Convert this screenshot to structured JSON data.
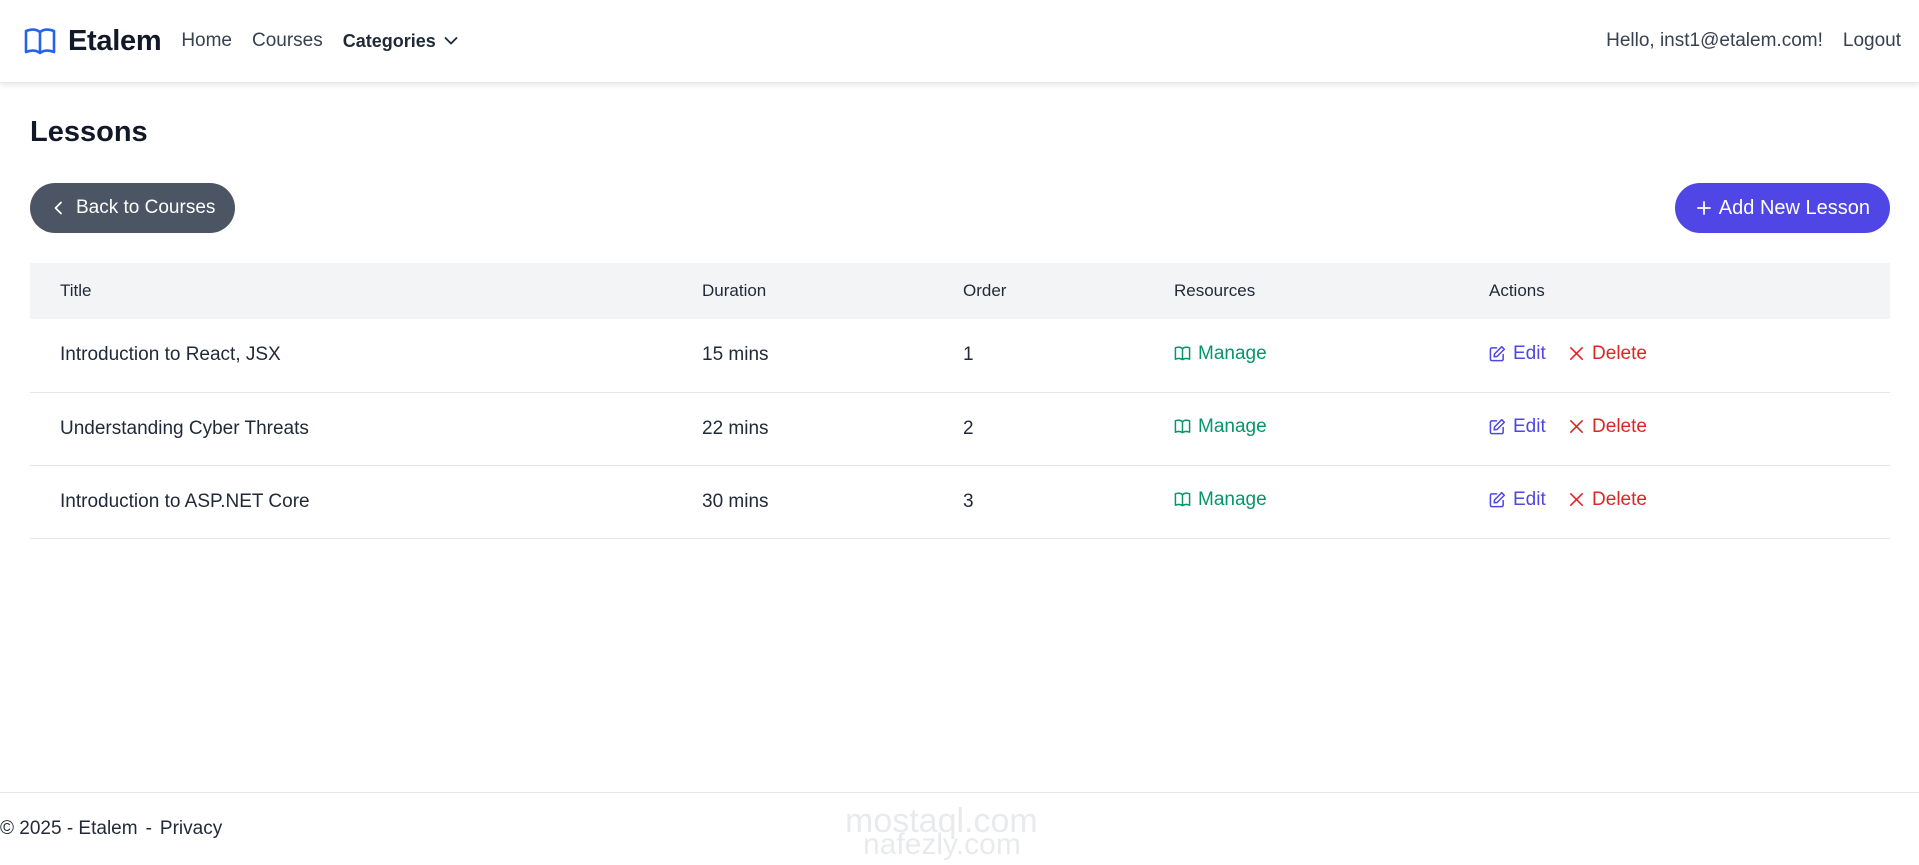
{
  "nav": {
    "brand": "Etalem",
    "links": {
      "home": "Home",
      "courses": "Courses",
      "categories": "Categories"
    },
    "greeting": "Hello, inst1@etalem.com!",
    "logout": "Logout"
  },
  "page": {
    "title": "Lessons",
    "back_label": "Back to Courses",
    "add_label": "Add New Lesson"
  },
  "table": {
    "headers": [
      "Title",
      "Duration",
      "Order",
      "Resources",
      "Actions"
    ],
    "rows": [
      {
        "title": "Introduction to React, JSX",
        "duration": "15 mins",
        "order": "1",
        "resources": "Manage",
        "edit": "Edit",
        "delete": "Delete"
      },
      {
        "title": "Understanding Cyber Threats",
        "duration": "22 mins",
        "order": "2",
        "resources": "Manage",
        "edit": "Edit",
        "delete": "Delete"
      },
      {
        "title": "Introduction to ASP.NET Core",
        "duration": "30 mins",
        "order": "3",
        "resources": "Manage",
        "edit": "Edit",
        "delete": "Delete"
      }
    ]
  },
  "footer": {
    "copyright": "© 2025 - Etalem",
    "separator": "-",
    "privacy": "Privacy"
  },
  "watermark": {
    "line1": "mostaql.com",
    "line2": "nafezly.com"
  },
  "colors": {
    "primary": "#4f46e5",
    "secondary": "#4b5563",
    "manage": "#059669",
    "edit": "#4f46e5",
    "delete": "#dc2626",
    "header_bg": "#f3f4f6"
  },
  "icons": {
    "brand": "book-open-icon",
    "categories": "chevron-down-icon",
    "back": "chevron-left-icon",
    "add": "plus-icon",
    "manage": "book-open-icon",
    "edit": "edit-icon",
    "delete": "x-icon"
  }
}
